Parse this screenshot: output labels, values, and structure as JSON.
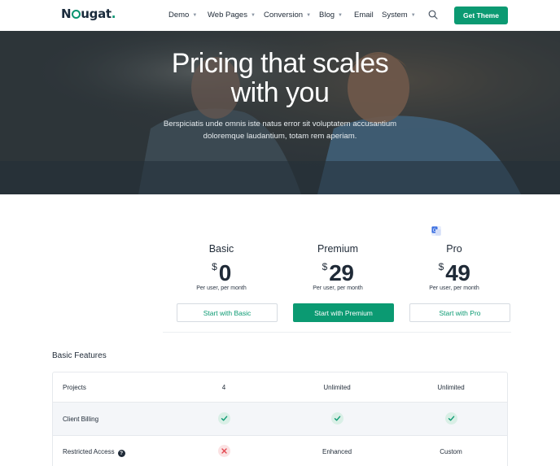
{
  "nav": {
    "logo_prefix": "N",
    "logo_suffix": "ugat",
    "logo_dot": ".",
    "menu": [
      {
        "label": "Demo",
        "caret": true
      },
      {
        "label": "Web Pages",
        "caret": true
      },
      {
        "label": "Conversion",
        "caret": true
      },
      {
        "label": "Blog",
        "caret": true
      },
      {
        "label": "Email",
        "caret": false
      },
      {
        "label": "System",
        "caret": true
      }
    ],
    "cta_label": "Get Theme"
  },
  "hero": {
    "title_line1": "Pricing that scales",
    "title_line2": "with you",
    "subtitle_line1": "Berspiciatis unde omnis iste natus error sit voluptatem accusantium",
    "subtitle_line2": "doloremque laudantium, totam rem aperiam."
  },
  "plans": [
    {
      "name": "Basic",
      "currency": "$",
      "price": "0",
      "period": "Per user, per month",
      "button": "Start with Basic"
    },
    {
      "name": "Premium",
      "currency": "$",
      "price": "29",
      "period": "Per user, per month",
      "button": "Start with Premium"
    },
    {
      "name": "Pro",
      "currency": "$",
      "price": "49",
      "period": "Per user, per month",
      "button": "Start with Pro"
    }
  ],
  "features": {
    "section_title": "Basic Features",
    "rows": [
      {
        "label": "Projects",
        "values": [
          "4",
          "Unlimited",
          "Unlimited"
        ]
      },
      {
        "label": "Client Billing",
        "values": [
          "check",
          "check",
          "check"
        ]
      },
      {
        "label": "Restricted Access",
        "help": "?",
        "values": [
          "cross",
          "Enhanced",
          "Custom"
        ]
      }
    ]
  },
  "colors": {
    "accent": "#0b9a72",
    "check_bg": "#d9efe6",
    "cross_bg": "#fbe2e3",
    "cross": "#e2474f"
  }
}
